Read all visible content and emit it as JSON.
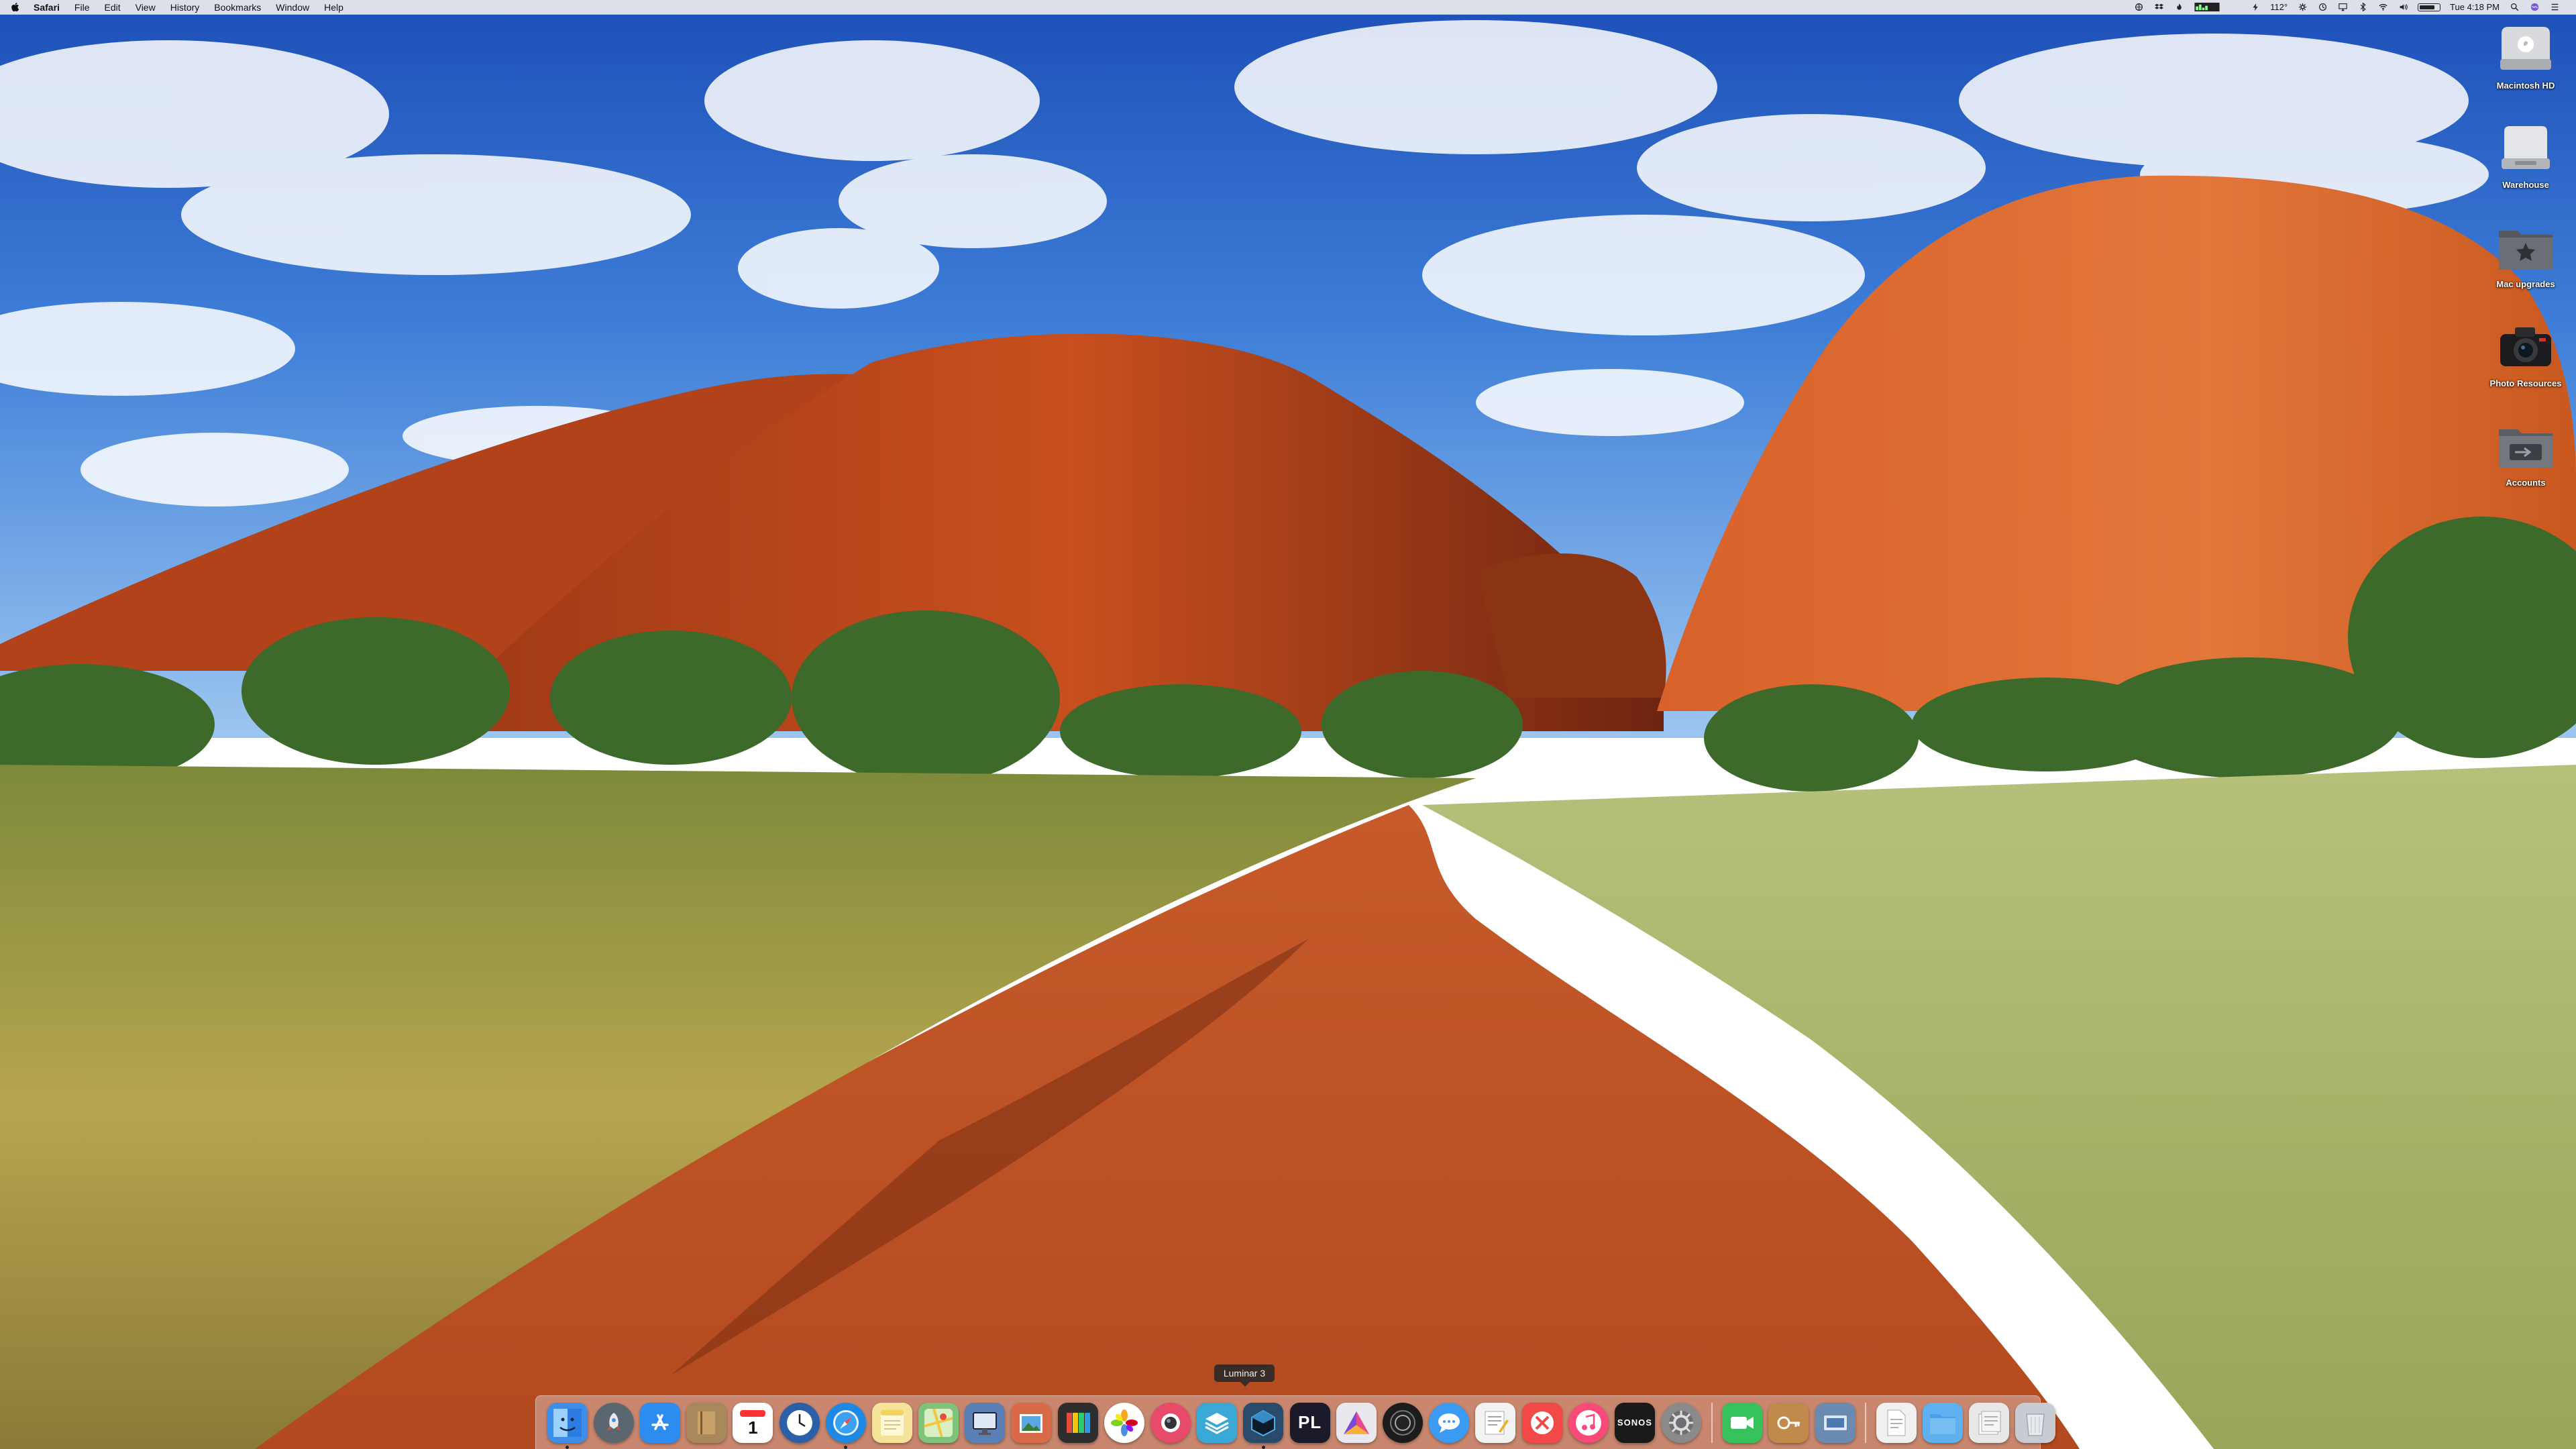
{
  "menubar": {
    "app_name": "Safari",
    "menus": [
      "File",
      "Edit",
      "View",
      "History",
      "Bookmarks",
      "Window",
      "Help"
    ],
    "status": {
      "temperature": "112°",
      "clock": "Tue 4:18 PM",
      "battery_level": 0.8
    }
  },
  "desktop": {
    "icons": [
      {
        "label": "Macintosh HD",
        "icon": "internal-drive-icon"
      },
      {
        "label": "Warehouse",
        "icon": "external-drive-icon"
      },
      {
        "label": "Mac upgrades",
        "icon": "folder-star-icon"
      },
      {
        "label": "Photo Resources",
        "icon": "camera-icon"
      },
      {
        "label": "Accounts",
        "icon": "folder-icon"
      }
    ]
  },
  "dock": {
    "tooltip": "Luminar 3",
    "apps": [
      {
        "name": "finder",
        "color": "#3d8ee8"
      },
      {
        "name": "launchpad",
        "color": "#5b6770"
      },
      {
        "name": "app-store",
        "color": "#2d8cf0"
      },
      {
        "name": "notefile",
        "color": "#a8875a"
      },
      {
        "name": "calendar",
        "color": "#ffffff"
      },
      {
        "name": "clock",
        "color": "#2b5fa8"
      },
      {
        "name": "safari",
        "color": "#1e88e5"
      },
      {
        "name": "notes",
        "color": "#f6e39a"
      },
      {
        "name": "maps",
        "color": "#7fc37b"
      },
      {
        "name": "screen-sharing",
        "color": "#5a7fb5"
      },
      {
        "name": "preview",
        "color": "#d86a4a"
      },
      {
        "name": "color-picker",
        "color": "#2e2e2e"
      },
      {
        "name": "photos",
        "color": "#ffffff"
      },
      {
        "name": "photo-booth",
        "color": "#e84a6a"
      },
      {
        "name": "affinity",
        "color": "#3aa8d6"
      },
      {
        "name": "luminar",
        "color": "#2a4a6a"
      },
      {
        "name": "photolab",
        "color": "#1a1a2a"
      },
      {
        "name": "affinity-photo",
        "color": "#e8e8ee"
      },
      {
        "name": "camera-raw",
        "color": "#1c1c1c"
      },
      {
        "name": "messages",
        "color": "#3b9af2"
      },
      {
        "name": "textedit",
        "color": "#f2f2f2"
      },
      {
        "name": "news",
        "color": "#f24848"
      },
      {
        "name": "itunes",
        "color": "#fa4a7a"
      },
      {
        "name": "sonos",
        "color": "#1a1a1a"
      },
      {
        "name": "system-preferences",
        "color": "#8a8a8a"
      },
      {
        "name": "facetime",
        "color": "#36c25a"
      },
      {
        "name": "keychain",
        "color": "#c08a4a"
      },
      {
        "name": "image-capture",
        "color": "#6a8ab0"
      },
      {
        "name": "documents-stack",
        "color": "#f0f0f0"
      },
      {
        "name": "downloads-folder",
        "color": "#5fb0ee"
      },
      {
        "name": "recent-stack",
        "color": "#e8e8e8"
      },
      {
        "name": "trash",
        "color": "#c8ccd2"
      }
    ],
    "labels": {
      "calendar_day": "1",
      "photolab": "PL",
      "sonos": "SONOS"
    }
  }
}
